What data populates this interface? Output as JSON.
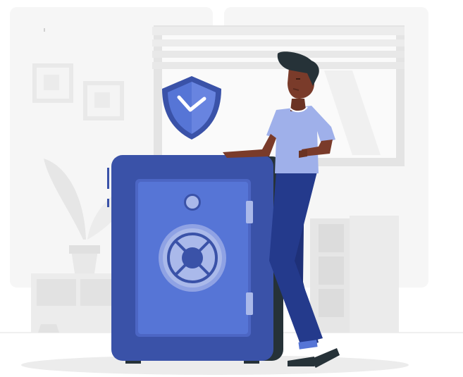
{
  "illustration": {
    "subject": "person-leaning-on-safe",
    "icons": [
      "shield-check-icon",
      "safe-icon",
      "combination-dial-icon",
      "window-icon",
      "plant-icon",
      "picture-frame-icon"
    ],
    "colors": {
      "background": "#ffffff",
      "backdrop": "#f4f4f4",
      "furniture": "#e6e6e6",
      "safe_body": "#3a52a8",
      "safe_door": "#5675d6",
      "safe_dial": "#aab9ea",
      "shield": "#4b67c9",
      "shirt": "#9fb0ea",
      "pants": "#243a8c",
      "skin": "#7a3b2a",
      "hair": "#263238"
    }
  }
}
